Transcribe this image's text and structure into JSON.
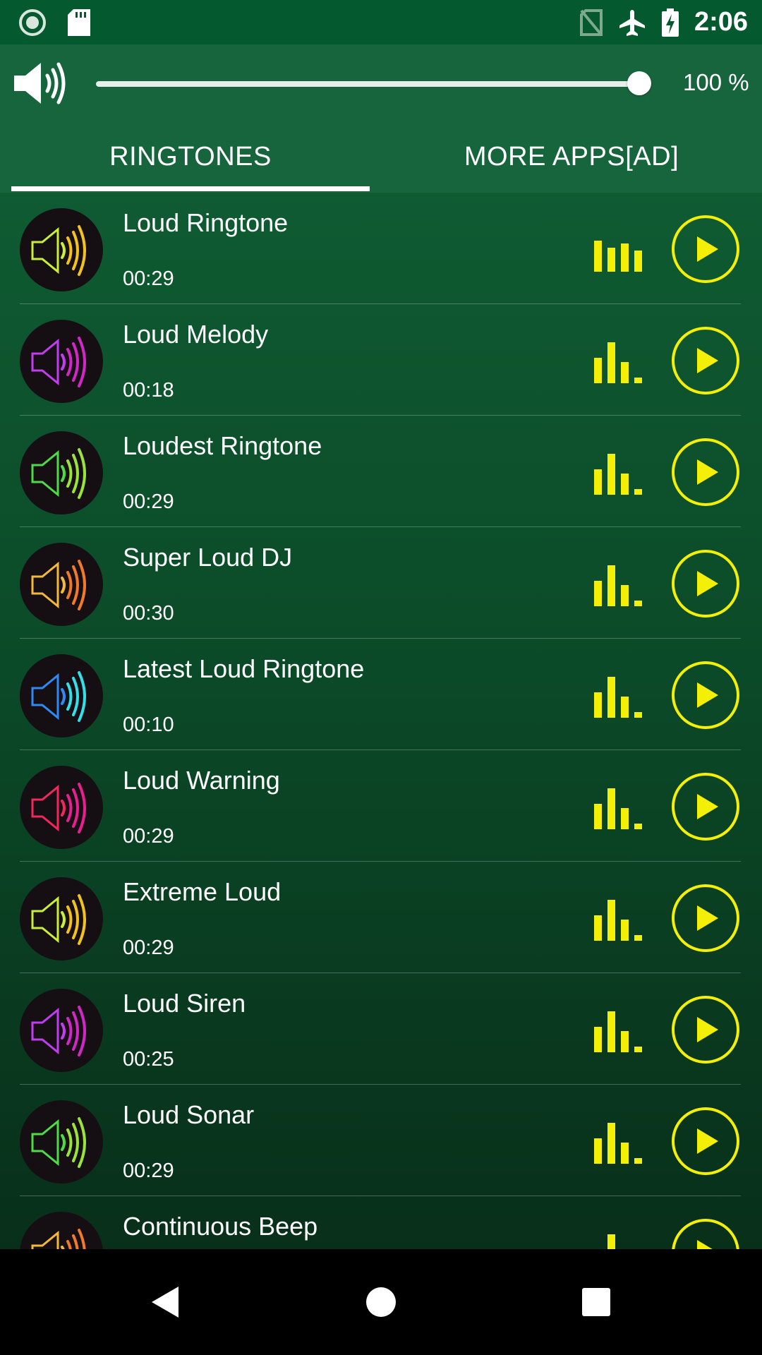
{
  "status_bar": {
    "time": "2:06",
    "icons": [
      "record-icon",
      "sd-card-icon",
      "no-sim-icon",
      "airplane-mode-icon",
      "battery-charging-icon"
    ]
  },
  "volume": {
    "icon": "speaker-icon",
    "level_percent": 100,
    "text": "100 %"
  },
  "tabs": [
    {
      "label": "RINGTONES",
      "selected": true
    },
    {
      "label": "MORE APPS[AD]",
      "selected": false
    }
  ],
  "ringtones": [
    {
      "title": "Loud Ringtone",
      "duration": "00:29",
      "icon_colors": [
        "#c9ef36",
        "#f4c21c"
      ],
      "playing": true
    },
    {
      "title": "Loud Melody",
      "duration": "00:18",
      "icon_colors": [
        "#c23df0",
        "#d227c7"
      ],
      "playing": false
    },
    {
      "title": "Loudest Ringtone",
      "duration": "00:29",
      "icon_colors": [
        "#4ddc45",
        "#9ae43a"
      ],
      "playing": false
    },
    {
      "title": "Super Loud DJ",
      "duration": "00:30",
      "icon_colors": [
        "#f5b93a",
        "#f07a2a"
      ],
      "playing": false
    },
    {
      "title": "Latest Loud Ringtone",
      "duration": "00:10",
      "icon_colors": [
        "#2f8bf3",
        "#33e0ea"
      ],
      "playing": false
    },
    {
      "title": "Loud Warning",
      "duration": "00:29",
      "icon_colors": [
        "#f2285c",
        "#e81f8e"
      ],
      "playing": false
    },
    {
      "title": "Extreme Loud",
      "duration": "00:29",
      "icon_colors": [
        "#c9ef36",
        "#f4c21c"
      ],
      "playing": false
    },
    {
      "title": "Loud Siren",
      "duration": "00:25",
      "icon_colors": [
        "#c23df0",
        "#d227c7"
      ],
      "playing": false
    },
    {
      "title": "Loud Sonar",
      "duration": "00:29",
      "icon_colors": [
        "#4ddc45",
        "#9ae43a"
      ],
      "playing": false
    },
    {
      "title": "Continuous Beep",
      "duration": "",
      "icon_colors": [
        "#f5b93a",
        "#f07a2a"
      ],
      "playing": false
    }
  ],
  "colors": {
    "accent_yellow": "#f4ef07",
    "toolbar_green": "#17653d",
    "status_green": "#045a2e"
  },
  "nav": {
    "icons": [
      "back-icon",
      "home-icon",
      "recent-apps-icon"
    ]
  }
}
